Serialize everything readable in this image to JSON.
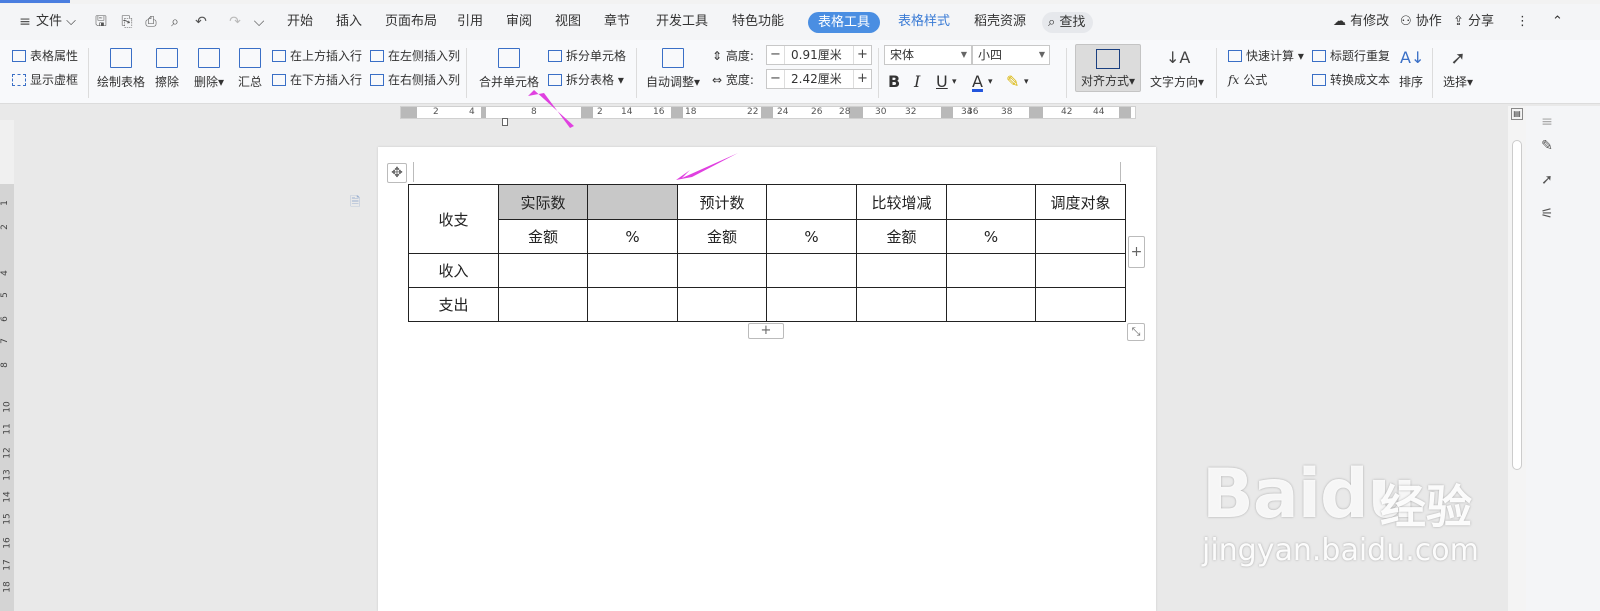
{
  "menubar": {
    "file": "文件",
    "tabs": [
      "开始",
      "插入",
      "页面布局",
      "引用",
      "审阅",
      "视图",
      "章节",
      "开发工具",
      "特色功能"
    ],
    "active_tab": "表格工具",
    "blue_tabs": [
      "表格样式",
      "稻壳资源"
    ],
    "search": "查找",
    "modified": "有修改",
    "collaborate": "协作",
    "share": "分享"
  },
  "ribbon": {
    "table_props": "表格属性",
    "show_gridlines": "显示虚框",
    "draw_table": "绘制表格",
    "erase": "擦除",
    "delete": "删除",
    "summary": "汇总",
    "insert_above": "在上方插入行",
    "insert_below": "在下方插入行",
    "insert_left": "在左侧插入列",
    "insert_right": "在右侧插入列",
    "merge_cells": "合并单元格",
    "split_cells": "拆分单元格",
    "split_table": "拆分表格",
    "auto_adjust": "自动调整",
    "height_label": "高度:",
    "height_value": "0.91厘米",
    "width_label": "宽度:",
    "width_value": "2.42厘米",
    "font_name": "宋体",
    "font_size": "小四",
    "align": "对齐方式",
    "text_direction": "文字方向",
    "quick_calc": "快速计算",
    "repeat_header": "标题行重复",
    "formula": "公式",
    "to_text": "转换成文本",
    "sort": "排序",
    "select": "选择"
  },
  "ruler_labels": [
    "2",
    "4",
    "8",
    "2",
    "14",
    "16",
    "18",
    "22",
    "24",
    "26",
    "28",
    "30",
    "32",
    "34",
    "36",
    "38",
    "42",
    "44"
  ],
  "left_ruler_labels": [
    "1",
    "2",
    "4",
    "5",
    "6",
    "7",
    "8",
    "10",
    "11",
    "12",
    "13",
    "14",
    "15",
    "16",
    "17",
    "18"
  ],
  "table": {
    "header1": [
      "收支",
      "实际数",
      "",
      "预计数",
      "",
      "比较增减",
      "",
      "调度对象"
    ],
    "header2": [
      "金额",
      "%",
      "金额",
      "%",
      "金额",
      "%",
      ""
    ],
    "rows": [
      [
        "收入",
        "",
        "",
        "",
        "",
        "",
        "",
        ""
      ],
      [
        "支出",
        "",
        "",
        "",
        "",
        "",
        "",
        ""
      ]
    ]
  },
  "watermark": {
    "brand": "Bai",
    "brand2": "du",
    "cn": "经验",
    "url": "jingyan.baidu.com"
  },
  "colors": {
    "accent_blue": "#4a8ee2",
    "arrow_magenta": "#e040e0",
    "selected_cell": "#c8c8c8"
  }
}
